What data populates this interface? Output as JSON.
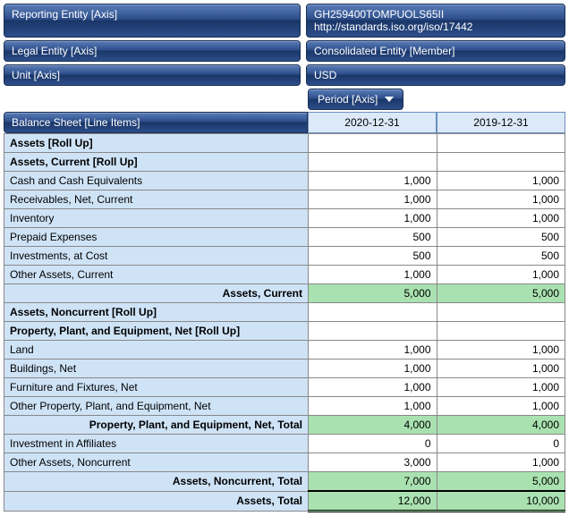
{
  "axes": {
    "reporting_entity": {
      "label": "Reporting Entity [Axis]",
      "value": "GH259400TOMPUOLS65II http://standards.iso.org/iso/17442"
    },
    "legal_entity": {
      "label": "Legal Entity [Axis]",
      "value": "Consolidated Entity [Member]"
    },
    "unit": {
      "label": "Unit [Axis]",
      "value": "USD"
    }
  },
  "period": {
    "label": "Period [Axis]",
    "cols": [
      "2020-12-31",
      "2019-12-31"
    ]
  },
  "line_items_header": "Balance Sheet [Line Items]",
  "rows": [
    {
      "type": "rollup",
      "label": "Assets [Roll Up]"
    },
    {
      "type": "rollup",
      "label": "Assets, Current [Roll Up]"
    },
    {
      "type": "item",
      "label": "Cash and Cash Equivalents",
      "v": [
        "1,000",
        "1,000"
      ]
    },
    {
      "type": "item",
      "label": "Receivables, Net, Current",
      "v": [
        "1,000",
        "1,000"
      ]
    },
    {
      "type": "item",
      "label": "Inventory",
      "v": [
        "1,000",
        "1,000"
      ]
    },
    {
      "type": "item",
      "label": "Prepaid Expenses",
      "v": [
        "500",
        "500"
      ]
    },
    {
      "type": "item",
      "label": "Investments, at Cost",
      "v": [
        "500",
        "500"
      ]
    },
    {
      "type": "item",
      "label": "Other Assets, Current",
      "v": [
        "1,000",
        "1,000"
      ]
    },
    {
      "type": "subtotal",
      "label": "Assets, Current",
      "v": [
        "5,000",
        "5,000"
      ]
    },
    {
      "type": "rollup",
      "label": "Assets, Noncurrent [Roll Up]"
    },
    {
      "type": "rollup",
      "label": "Property, Plant, and Equipment, Net [Roll Up]"
    },
    {
      "type": "item",
      "label": "Land",
      "v": [
        "1,000",
        "1,000"
      ]
    },
    {
      "type": "item",
      "label": "Buildings, Net",
      "v": [
        "1,000",
        "1,000"
      ]
    },
    {
      "type": "item",
      "label": "Furniture and Fixtures, Net",
      "v": [
        "1,000",
        "1,000"
      ]
    },
    {
      "type": "item",
      "label": "Other Property, Plant, and Equipment, Net",
      "v": [
        "1,000",
        "1,000"
      ]
    },
    {
      "type": "subtotal",
      "label": "Property, Plant, and Equipment, Net, Total",
      "v": [
        "4,000",
        "4,000"
      ]
    },
    {
      "type": "item",
      "label": "Investment in Affiliates",
      "v": [
        "0",
        "0"
      ]
    },
    {
      "type": "item",
      "label": "Other Assets, Noncurrent",
      "v": [
        "3,000",
        "1,000"
      ]
    },
    {
      "type": "subtotal",
      "label": "Assets, Noncurrent, Total",
      "v": [
        "7,000",
        "5,000"
      ]
    },
    {
      "type": "grandtotal",
      "label": "Assets, Total",
      "v": [
        "12,000",
        "10,000"
      ]
    }
  ],
  "chart_data": {
    "type": "table",
    "title": "Balance Sheet [Line Items]",
    "categories": [
      "2020-12-31",
      "2019-12-31"
    ],
    "series": [
      {
        "name": "Cash and Cash Equivalents",
        "values": [
          1000,
          1000
        ]
      },
      {
        "name": "Receivables, Net, Current",
        "values": [
          1000,
          1000
        ]
      },
      {
        "name": "Inventory",
        "values": [
          1000,
          1000
        ]
      },
      {
        "name": "Prepaid Expenses",
        "values": [
          500,
          500
        ]
      },
      {
        "name": "Investments, at Cost",
        "values": [
          500,
          500
        ]
      },
      {
        "name": "Other Assets, Current",
        "values": [
          1000,
          1000
        ]
      },
      {
        "name": "Assets, Current",
        "values": [
          5000,
          5000
        ]
      },
      {
        "name": "Land",
        "values": [
          1000,
          1000
        ]
      },
      {
        "name": "Buildings, Net",
        "values": [
          1000,
          1000
        ]
      },
      {
        "name": "Furniture and Fixtures, Net",
        "values": [
          1000,
          1000
        ]
      },
      {
        "name": "Other Property, Plant, and Equipment, Net",
        "values": [
          1000,
          1000
        ]
      },
      {
        "name": "Property, Plant, and Equipment, Net, Total",
        "values": [
          4000,
          4000
        ]
      },
      {
        "name": "Investment in Affiliates",
        "values": [
          0,
          0
        ]
      },
      {
        "name": "Other Assets, Noncurrent",
        "values": [
          3000,
          1000
        ]
      },
      {
        "name": "Assets, Noncurrent, Total",
        "values": [
          7000,
          5000
        ]
      },
      {
        "name": "Assets, Total",
        "values": [
          12000,
          10000
        ]
      }
    ]
  }
}
